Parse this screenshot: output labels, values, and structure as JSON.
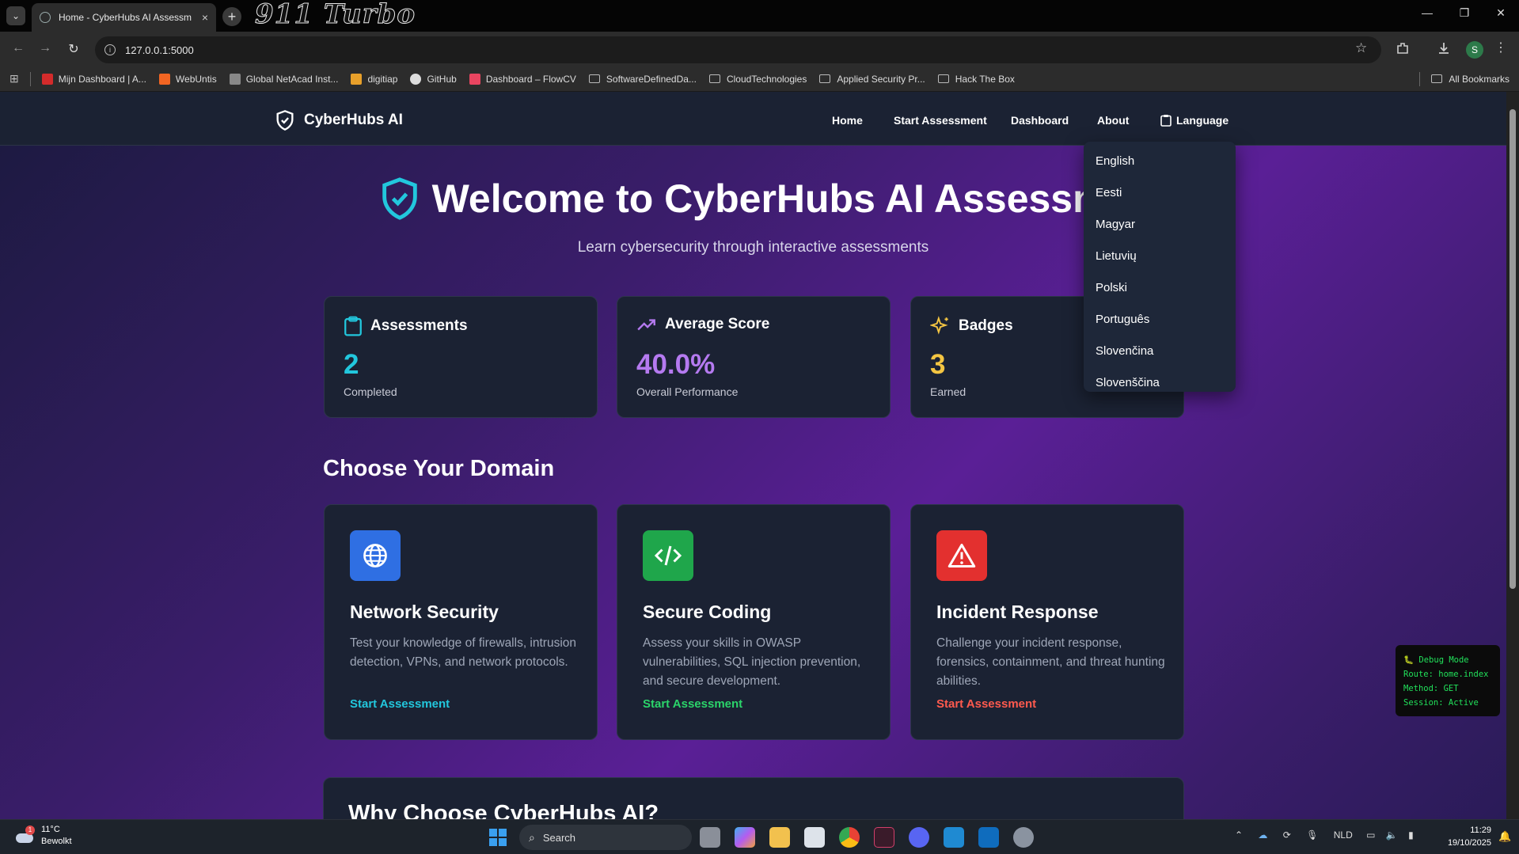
{
  "browser": {
    "tab_title": "Home - CyberHubs AI Assessm",
    "tab_close": "×",
    "new_tab": "+",
    "brand_overlay": "911 Turbo",
    "url": "127.0.0.1:5000",
    "profile_initial": "S",
    "window_controls": {
      "minimize": "—",
      "restore": "❐",
      "close": "✕"
    },
    "bookmarks": [
      {
        "label": "Mijn Dashboard | A...",
        "color": "#d42b2b"
      },
      {
        "label": "WebUntis",
        "color": "#f26522"
      },
      {
        "label": "Global NetAcad Inst...",
        "color": "#888888"
      },
      {
        "label": "digitiap",
        "color": "#e8a02a"
      },
      {
        "label": "GitHub",
        "color": "#dddddd"
      },
      {
        "label": "Dashboard – FlowCV",
        "color": "#e94560"
      }
    ],
    "bookmark_folders": [
      "SoftwareDefinedDa...",
      "CloudTechnologies",
      "Applied Security Pr...",
      "Hack The Box"
    ],
    "all_bookmarks": "All Bookmarks"
  },
  "app": {
    "brand": "CyberHubs AI",
    "nav": {
      "home": "Home",
      "start_assessment": "Start Assessment",
      "dashboard": "Dashboard",
      "about": "About",
      "language": "Language"
    },
    "language_options": [
      "English",
      "Eesti",
      "Magyar",
      "Lietuvių",
      "Polski",
      "Português",
      "Slovenčina",
      "Slovenščina"
    ],
    "hero": {
      "title": "Welcome to CyberHubs AI Assessme",
      "subtitle": "Learn cybersecurity through interactive assessments"
    },
    "stats": [
      {
        "title": "Assessments",
        "value": "2",
        "label": "Completed",
        "color": "#22c7dd"
      },
      {
        "title": "Average Score",
        "value": "40.0%",
        "label": "Overall Performance",
        "color": "#b57af0"
      },
      {
        "title": "Badges",
        "value": "3",
        "label": "Earned",
        "color": "#f4c542"
      }
    ],
    "domains_title": "Choose Your Domain",
    "domains": [
      {
        "title": "Network Security",
        "desc": "Test your knowledge of firewalls, intrusion detection, VPNs, and network protocols.",
        "link": "Start Assessment",
        "icon": "globe-icon",
        "color": "#2f6fe3",
        "link_color": "#22c7dd"
      },
      {
        "title": "Secure Coding",
        "desc": "Assess your skills in OWASP vulnerabilities, SQL injection prevention, and secure development.",
        "link": "Start Assessment",
        "icon": "code-icon",
        "color": "#1fa64b",
        "link_color": "#2bd46a"
      },
      {
        "title": "Incident Response",
        "desc": "Challenge your incident response, forensics, containment, and threat hunting abilities.",
        "link": "Start Assessment",
        "icon": "warning-icon",
        "color": "#e3302f",
        "link_color": "#ff5a4e"
      }
    ],
    "why_title": "Why Choose CyberHubs AI?",
    "debug": {
      "title": "Debug Mode",
      "route": "Route: home.index",
      "method": "Method: GET",
      "session": "Session: Active"
    }
  },
  "taskbar": {
    "weather_temp": "11°C",
    "weather_desc": "Bewolkt",
    "weather_alert": "1",
    "search": "Search",
    "language": "NLD",
    "time": "11:29",
    "date": "19/10/2025"
  }
}
